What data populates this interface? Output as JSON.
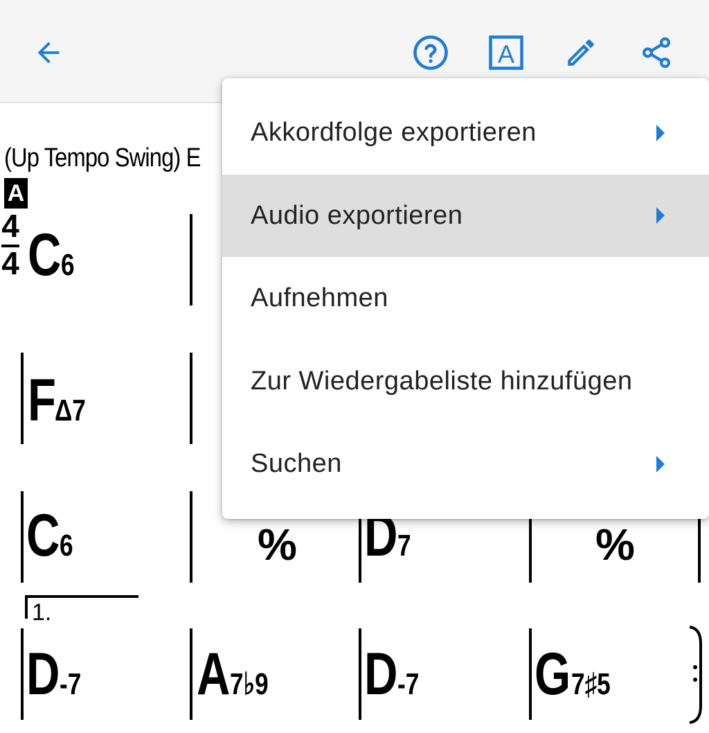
{
  "toolbar": {
    "back_icon": "arrow-left-icon",
    "help_icon": "help-circle-icon",
    "font_icon": "font-a-icon",
    "font_label": "A",
    "edit_icon": "pencil-icon",
    "share_icon": "share-icon",
    "accent_color": "#1e7bd6"
  },
  "sheet": {
    "style_text": "(Up Tempo Swing) E",
    "section_label": "A",
    "time_sig_top": "4",
    "time_sig_bottom": "4",
    "ending_label": "1.",
    "repeat_symbol": "%",
    "chords": [
      {
        "root": "C",
        "ext": "6"
      },
      {
        "root": "F",
        "ext": "Δ7"
      },
      {
        "root": "C",
        "ext": "6"
      },
      {
        "root": "D",
        "ext": "7"
      },
      {
        "root": "D",
        "ext": "-7"
      },
      {
        "root": "A",
        "ext": "7♭9"
      },
      {
        "root": "D",
        "ext": "-7"
      },
      {
        "root": "G",
        "ext": "7♯5"
      }
    ]
  },
  "menu": {
    "items": [
      {
        "label": "Akkordfolge exportieren",
        "has_submenu": true
      },
      {
        "label": "Audio exportieren",
        "has_submenu": true
      },
      {
        "label": "Aufnehmen",
        "has_submenu": false
      },
      {
        "label": "Zur Wiedergabeliste hinzufügen",
        "has_submenu": false
      },
      {
        "label": "Suchen",
        "has_submenu": true
      }
    ]
  }
}
